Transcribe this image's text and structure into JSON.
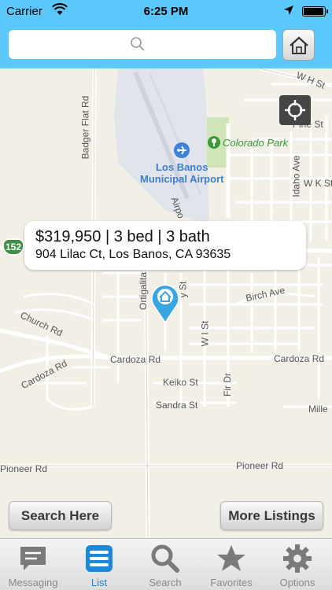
{
  "status_bar": {
    "carrier": "Carrier",
    "time": "6:25 PM"
  },
  "search": {
    "placeholder": ""
  },
  "map": {
    "streets": {
      "w_h_st": "W H St",
      "pine_st": "Pine St",
      "badger_flat_rd": "Badger Flat Rd",
      "idaho_ave": "Idaho Ave",
      "w_k_st": "W K St",
      "airport": "Airpo",
      "ortigalita": "Ortigalita",
      "sky": "y St",
      "church_rd": "Church Rd",
      "birch_ave": "Birch Ave",
      "w_i_st": "W I St",
      "cardoza_rd_1": "Cardoza Rd",
      "cardoza_rd_2": "Cardoza Rd",
      "cardoza_rd_3": "Cardoza Rd",
      "keiko_st": "Keiko St",
      "fir_dr": "Fir Dr",
      "sandra_st": "Sandra St",
      "mille": "Mille",
      "pioneer_rd_1": "Pioneer Rd",
      "pioneer_rd_2": "Pioneer Rd",
      "route": "152"
    },
    "park_name": "Colorado Park",
    "airport_name_1": "Los Banos",
    "airport_name_2": "Municipal Airport"
  },
  "listing": {
    "summary": "$319,950 | 3 bed | 3 bath",
    "address": "904 Lilac Ct, Los Banos, CA 93635"
  },
  "buttons": {
    "search_here": "Search Here",
    "more_listings": "More Listings"
  },
  "tabs": [
    {
      "label": "Messaging",
      "icon": "message-icon"
    },
    {
      "label": "List",
      "icon": "list-icon"
    },
    {
      "label": "Search",
      "icon": "search-icon"
    },
    {
      "label": "Favorites",
      "icon": "star-icon"
    },
    {
      "label": "Options",
      "icon": "gear-icon"
    }
  ],
  "active_tab": "List",
  "colors": {
    "header": "#5ac8fa",
    "accent": "#1e88d8",
    "pin": "#3aa6e0",
    "park": "#3a9a3a"
  }
}
